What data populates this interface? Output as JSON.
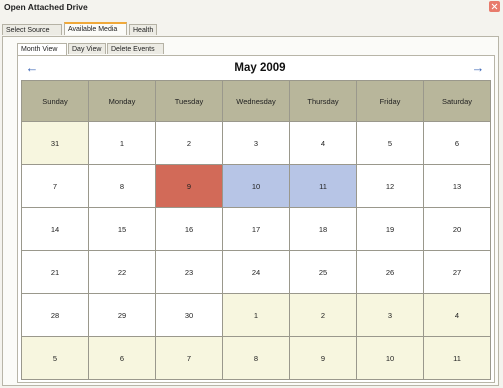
{
  "window": {
    "title": "Open Attached Drive"
  },
  "main_tabs": [
    {
      "label": "Select Source",
      "active": false
    },
    {
      "label": "Available Media",
      "active": true
    },
    {
      "label": "Health",
      "active": false
    }
  ],
  "view_tabs": [
    {
      "label": "Month View",
      "active": true
    },
    {
      "label": "Day View",
      "active": false
    },
    {
      "label": "Delete Events",
      "active": false
    }
  ],
  "calendar": {
    "month_title": "May 2009",
    "prev_icon": "left-arrow-icon",
    "next_icon": "right-arrow-icon",
    "weekdays": [
      "Sunday",
      "Monday",
      "Tuesday",
      "Wednesday",
      "Thursday",
      "Friday",
      "Saturday"
    ],
    "weeks": [
      [
        {
          "d": "31",
          "s": "other"
        },
        {
          "d": "1",
          "s": ""
        },
        {
          "d": "2",
          "s": ""
        },
        {
          "d": "3",
          "s": ""
        },
        {
          "d": "4",
          "s": ""
        },
        {
          "d": "5",
          "s": ""
        },
        {
          "d": "6",
          "s": ""
        }
      ],
      [
        {
          "d": "7",
          "s": ""
        },
        {
          "d": "8",
          "s": ""
        },
        {
          "d": "9",
          "s": "red"
        },
        {
          "d": "10",
          "s": "blue"
        },
        {
          "d": "11",
          "s": "blue"
        },
        {
          "d": "12",
          "s": ""
        },
        {
          "d": "13",
          "s": ""
        }
      ],
      [
        {
          "d": "14",
          "s": ""
        },
        {
          "d": "15",
          "s": ""
        },
        {
          "d": "16",
          "s": ""
        },
        {
          "d": "17",
          "s": ""
        },
        {
          "d": "18",
          "s": ""
        },
        {
          "d": "19",
          "s": ""
        },
        {
          "d": "20",
          "s": ""
        }
      ],
      [
        {
          "d": "21",
          "s": ""
        },
        {
          "d": "22",
          "s": ""
        },
        {
          "d": "23",
          "s": ""
        },
        {
          "d": "24",
          "s": ""
        },
        {
          "d": "25",
          "s": ""
        },
        {
          "d": "26",
          "s": ""
        },
        {
          "d": "27",
          "s": ""
        }
      ],
      [
        {
          "d": "28",
          "s": ""
        },
        {
          "d": "29",
          "s": ""
        },
        {
          "d": "30",
          "s": ""
        },
        {
          "d": "1",
          "s": "other"
        },
        {
          "d": "2",
          "s": "other"
        },
        {
          "d": "3",
          "s": "other"
        },
        {
          "d": "4",
          "s": "other"
        }
      ],
      [
        {
          "d": "5",
          "s": "other"
        },
        {
          "d": "6",
          "s": "other"
        },
        {
          "d": "7",
          "s": "other"
        },
        {
          "d": "8",
          "s": "other"
        },
        {
          "d": "9",
          "s": "other"
        },
        {
          "d": "10",
          "s": "other"
        },
        {
          "d": "11",
          "s": "other"
        }
      ]
    ]
  },
  "colors": {
    "highlight_red": "#d26a58",
    "highlight_blue": "#b7c5e6",
    "other_month": "#f7f6df",
    "header": "#b8b69b",
    "active_tab_accent": "#f0a93a"
  }
}
